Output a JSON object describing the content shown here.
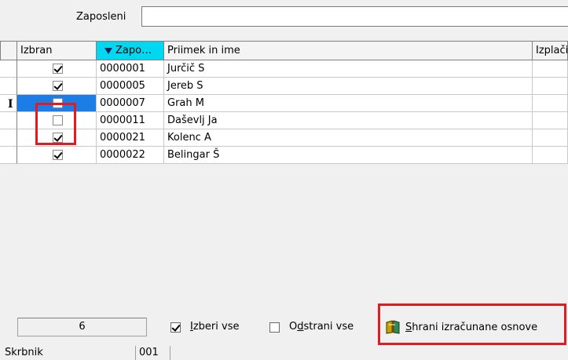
{
  "filter": {
    "label": "Zaposleni",
    "value": ""
  },
  "grid": {
    "headers": {
      "izbran": "Izbran",
      "zapo": "Zapo…",
      "ime": "Priimek in ime",
      "izplac": "Izplači"
    },
    "rows": [
      {
        "checked": true,
        "code": "0000001",
        "name": "Jurčič S"
      },
      {
        "checked": true,
        "code": "0000005",
        "name": "Jereb S"
      },
      {
        "checked": false,
        "code": "0000007",
        "name": "Grah M"
      },
      {
        "checked": false,
        "code": "0000011",
        "name": "Daševlj Ja"
      },
      {
        "checked": true,
        "code": "0000021",
        "name": "Kolenc A"
      },
      {
        "checked": true,
        "code": "0000022",
        "name": "Belingar Š"
      }
    ]
  },
  "toolbar": {
    "count": "6",
    "select_all": {
      "prefix": "",
      "underline": "I",
      "rest": "zberi vse",
      "checked": true
    },
    "remove_all": {
      "prefix": "O",
      "underline": "d",
      "rest": "strani vse",
      "checked": false
    },
    "save": {
      "underline": "S",
      "rest": "hrani izračunane osnove"
    }
  },
  "status": {
    "label": "Skrbnik",
    "value": "001"
  },
  "colors": {
    "highlight": "#e21b23",
    "sorted_header": "#00d8f2",
    "selection": "#1c7ee4"
  }
}
